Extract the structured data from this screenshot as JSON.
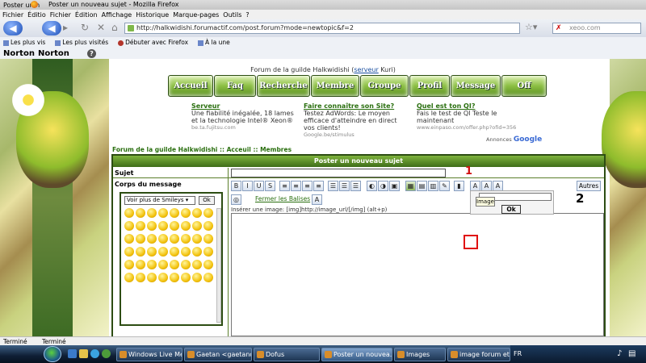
{
  "window": {
    "title_short": "Poster un n",
    "title": "Poster un nouveau sujet - Mozilla Firefox"
  },
  "menu": [
    "Fichier",
    "Édition",
    "Affichage",
    "Historique",
    "Marque-pages",
    "Outils",
    "?"
  ],
  "menu_overlap": [
    "Fichier",
    "Éditio"
  ],
  "nav": {
    "url": "http://halkwidishi.forumactif.com/post.forum?mode=newtopic&f=2",
    "search_placeholder": "xeoo.com"
  },
  "bookmarks": [
    "Les plus vis",
    "Les plus visités",
    "Débuter avec Firefox",
    "À la une"
  ],
  "norton": [
    "Norton",
    "Norton"
  ],
  "forum": {
    "title_prefix": "Forum de la guilde Halkwidishi (",
    "server_link": "serveur",
    "title_suffix": " Kuri)",
    "nav_buttons": [
      "Accueil",
      "Faq",
      "Recherche",
      "Membre",
      "Groupe",
      "Profil",
      "Message",
      "Off"
    ],
    "ads": [
      {
        "h": "Serveur",
        "d": "Une fiabilité inégalée, 18 lames et la technologie Intel® Xeon®",
        "u": "be.ta.fujitsu.com"
      },
      {
        "h": "Faire connaître son Site?",
        "d": "Testez AdWords: Le moyen efficace d'atteindre en direct vos clients!",
        "u": "Google.be/stimulus"
      },
      {
        "h": "Quel est ton QI?",
        "d": "Fais le test de QI Teste le maintenant",
        "u": "www.einpaso.com/offer.php?ofid=356"
      }
    ],
    "annonces": "Annonces",
    "google": "Google",
    "breadcrumb": "Forum de la guilde Halkwidishi  :: Acceuil :: Membres"
  },
  "form": {
    "header": "Poster un nouveau sujet",
    "subject_label": "Sujet",
    "body_label": "Corps du message",
    "smiley_select": "Voir plus de Smileys",
    "smiley_ok": "Ok",
    "toolbar_buttons": [
      "B",
      "I",
      "U",
      "S",
      "≡",
      "≡",
      "≡",
      "≡",
      "☰",
      "☰",
      "☰",
      "◐",
      "◑",
      "▣",
      "▦",
      "▤",
      "▥",
      "✎",
      "▮",
      "A",
      "A",
      "A"
    ],
    "autres": "Autres",
    "fermer": "Fermer les Balises",
    "insert_hint": "Insérer une image: [img]http://image_url/[/img] (alt+p)",
    "popup_ok": "Ok",
    "tooltip": "Image"
  },
  "annotations": {
    "one": "1",
    "two": "2"
  },
  "status": [
    "Terminé",
    "Terminé"
  ],
  "taskbar": [
    {
      "label": "Windows Live Me...",
      "active": false
    },
    {
      "label": "Gaetan <gaetand...",
      "active": false
    },
    {
      "label": "Dofus",
      "active": false
    },
    {
      "label": "Poster un nouvea...",
      "active": true
    },
    {
      "label": "Images",
      "active": false
    },
    {
      "label": "image forum eta...",
      "active": false
    }
  ],
  "tray": {
    "lang": "FR"
  }
}
